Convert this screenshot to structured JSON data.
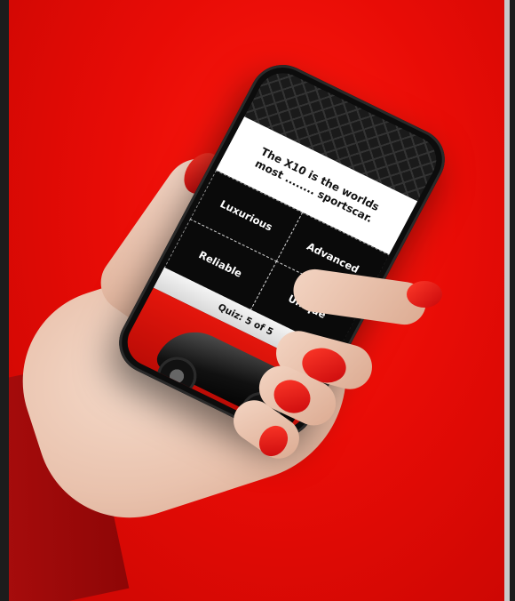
{
  "quiz": {
    "question_line1": "The X10 is the worlds",
    "question_line2": "most ........ sportscar.",
    "options": [
      "Luxurious",
      "Advanced",
      "Reliable",
      "Unique"
    ],
    "progress": "Quiz: 5 of 5"
  },
  "colors": {
    "background": "#e80c06",
    "nail": "#e0100c",
    "screen_dark": "#0a0a0a"
  }
}
